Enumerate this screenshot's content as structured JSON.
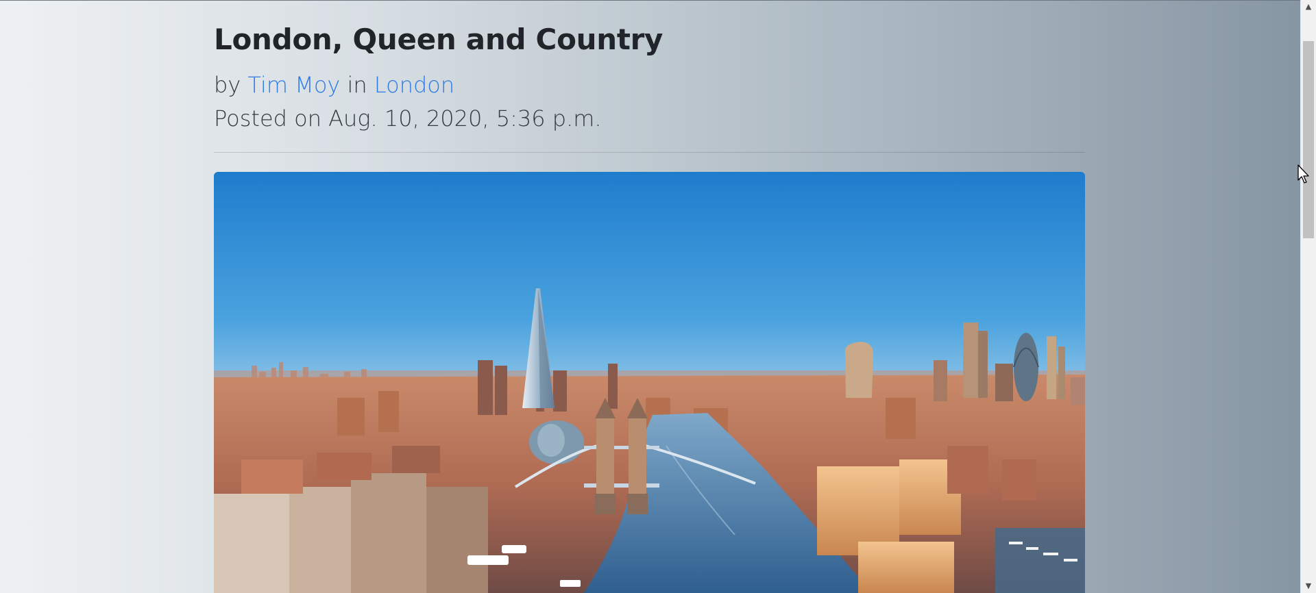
{
  "post": {
    "title": "London, Queen and Country",
    "by_prefix": "by",
    "author": "Tim Moy",
    "in_word": "in",
    "location": "London",
    "posted_label": "Posted on Aug. 10, 2020, 5:36 p.m."
  },
  "hero_image": {
    "alt": "Aerial view of London with Tower Bridge and the Thames"
  },
  "colors": {
    "link": "#2d7be5",
    "title": "#212529",
    "sky_top": "#1f7fce",
    "horizon": "#f4c898"
  },
  "icons": {
    "scroll_up": "triangle-up",
    "scroll_down": "triangle-down",
    "cursor": "arrow-pointer"
  }
}
